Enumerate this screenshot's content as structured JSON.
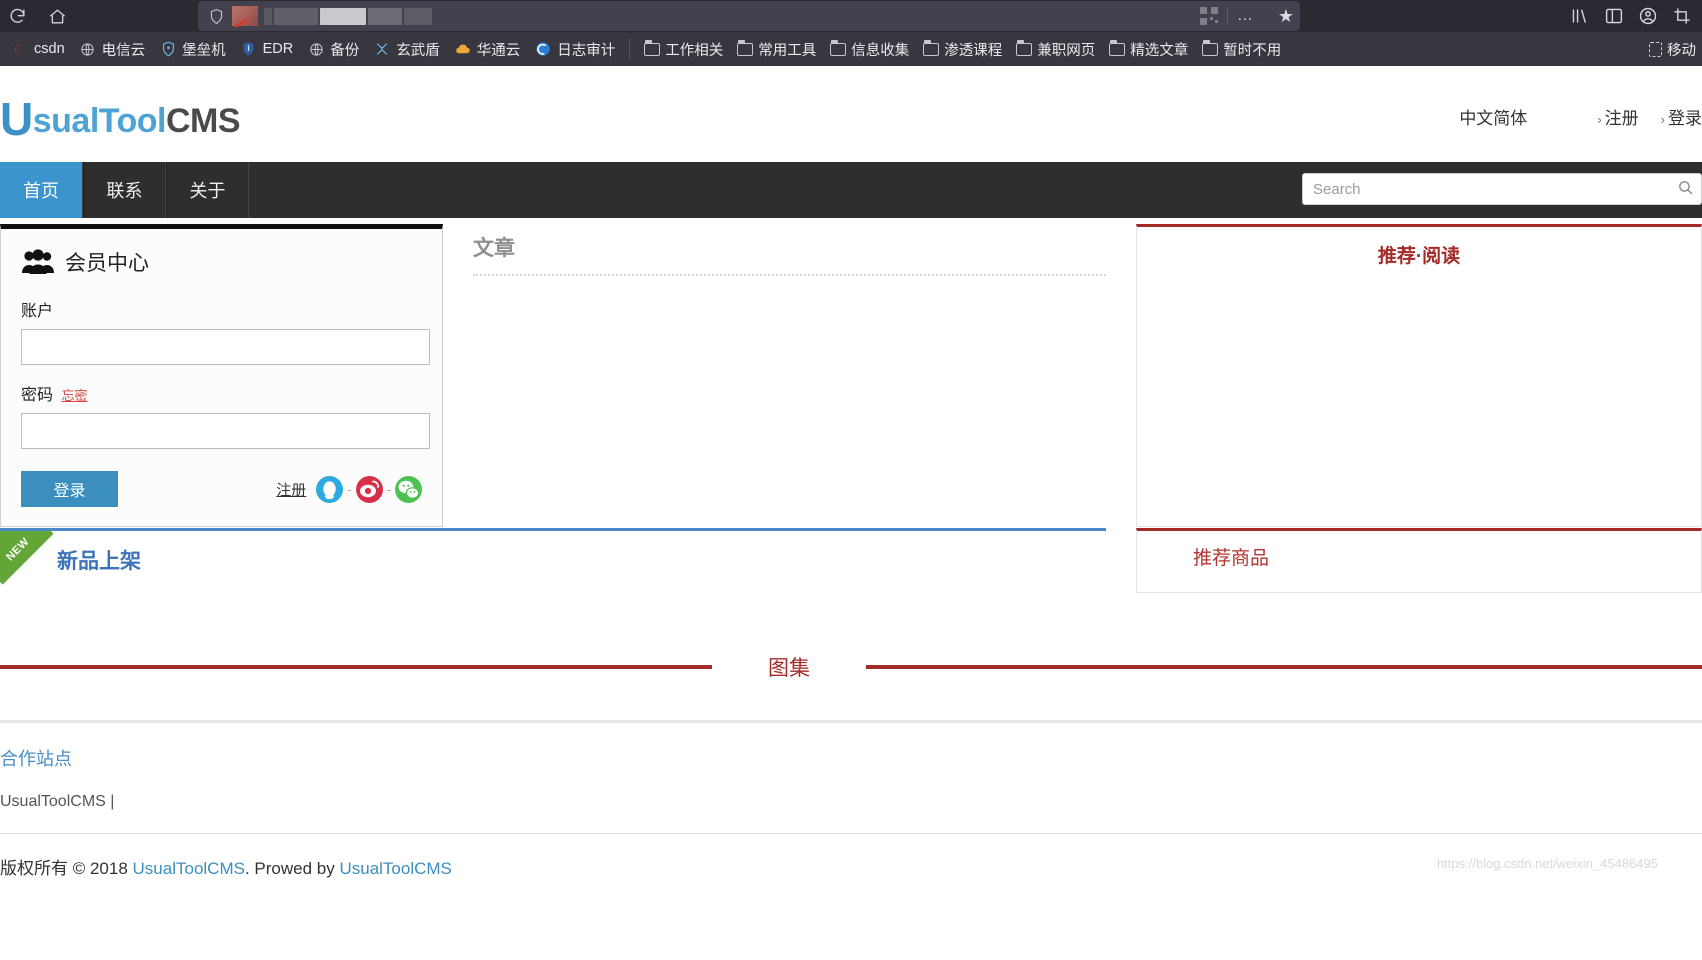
{
  "browser": {
    "toolbar": {
      "reload_icon": "reload-icon",
      "home_icon": "home-icon",
      "shield_icon": "tracking-protection-shield-icon",
      "qr_icon": "qr-code-icon",
      "more_icon": "…",
      "bookmark_star_icon": "★",
      "library_icon": "library-icon",
      "sidebar_icon": "sidebar-icon",
      "account_icon": "account-icon",
      "extension_icon": "extension-icon"
    },
    "bookmarks": [
      {
        "label": "csdn",
        "icon": "csdn-icon"
      },
      {
        "label": "电信云",
        "icon": "globe-icon"
      },
      {
        "label": "堡垒机",
        "icon": "shield-blue-icon"
      },
      {
        "label": "EDR",
        "icon": "shield-navy-icon"
      },
      {
        "label": "备份",
        "icon": "globe-icon"
      },
      {
        "label": "玄武盾",
        "icon": "xuanwu-icon"
      },
      {
        "label": "华通云",
        "icon": "cloud-icon"
      },
      {
        "label": "日志审计",
        "icon": "spiral-icon"
      },
      {
        "label": "工作相关",
        "icon": "folder-icon"
      },
      {
        "label": "常用工具",
        "icon": "folder-icon"
      },
      {
        "label": "信息收集",
        "icon": "folder-icon"
      },
      {
        "label": "渗透课程",
        "icon": "folder-icon"
      },
      {
        "label": "兼职网页",
        "icon": "folder-icon"
      },
      {
        "label": "精选文章",
        "icon": "folder-icon"
      },
      {
        "label": "暂时不用",
        "icon": "folder-icon"
      }
    ],
    "bookmarks_overflow": "移动"
  },
  "site": {
    "logo": {
      "u": "U",
      "mid": "sualTool",
      "suffix": "CMS"
    },
    "header_links": {
      "language": "中文简体",
      "register": "注册",
      "login": "登录",
      "caret": "›"
    },
    "nav": [
      {
        "label": "首页",
        "active": true
      },
      {
        "label": "联系",
        "active": false
      },
      {
        "label": "关于",
        "active": false
      }
    ],
    "search": {
      "placeholder": "Search",
      "value": "",
      "icon": "search-icon"
    },
    "login_panel": {
      "title": "会员中心",
      "title_icon": "users-icon",
      "account_label": "账户",
      "account_value": "",
      "password_label": "密码",
      "forgot_label": "忘密",
      "password_value": "",
      "submit_label": "登录",
      "register_label": "注册",
      "social": [
        {
          "name": "qq-icon",
          "color": "#2eaae0"
        },
        {
          "name": "weibo-icon",
          "color": "#d6304a"
        },
        {
          "name": "wechat-icon",
          "color": "#4cc252"
        }
      ],
      "social_sep": "-"
    },
    "article_section": {
      "title": "文章"
    },
    "recommend_read": {
      "title": "推荐·阅读"
    },
    "new_products": {
      "title": "新品上架",
      "ribbon": "NEW"
    },
    "recommend_products": {
      "title": "推荐商品"
    },
    "gallery": {
      "title": "图集"
    },
    "footer": {
      "partner_title": "合作站点",
      "partner_links": "UsualToolCMS |",
      "copyright_prefix": "版权所有 © 2018",
      "copyright_link1": "UsualToolCMS",
      "copyright_mid": ". Prowed by",
      "copyright_link2": "UsualToolCMS"
    },
    "watermark": "https://blog.csdn.net/weixin_45486495"
  },
  "colors": {
    "accent_blue": "#3b94cc",
    "brand_red": "#a32b28",
    "ribbon_green": "#63a637",
    "chrome_bg": "#2b2a33",
    "bookmarks_bg": "#38373f",
    "navbar_bg": "#2e2e2e"
  }
}
